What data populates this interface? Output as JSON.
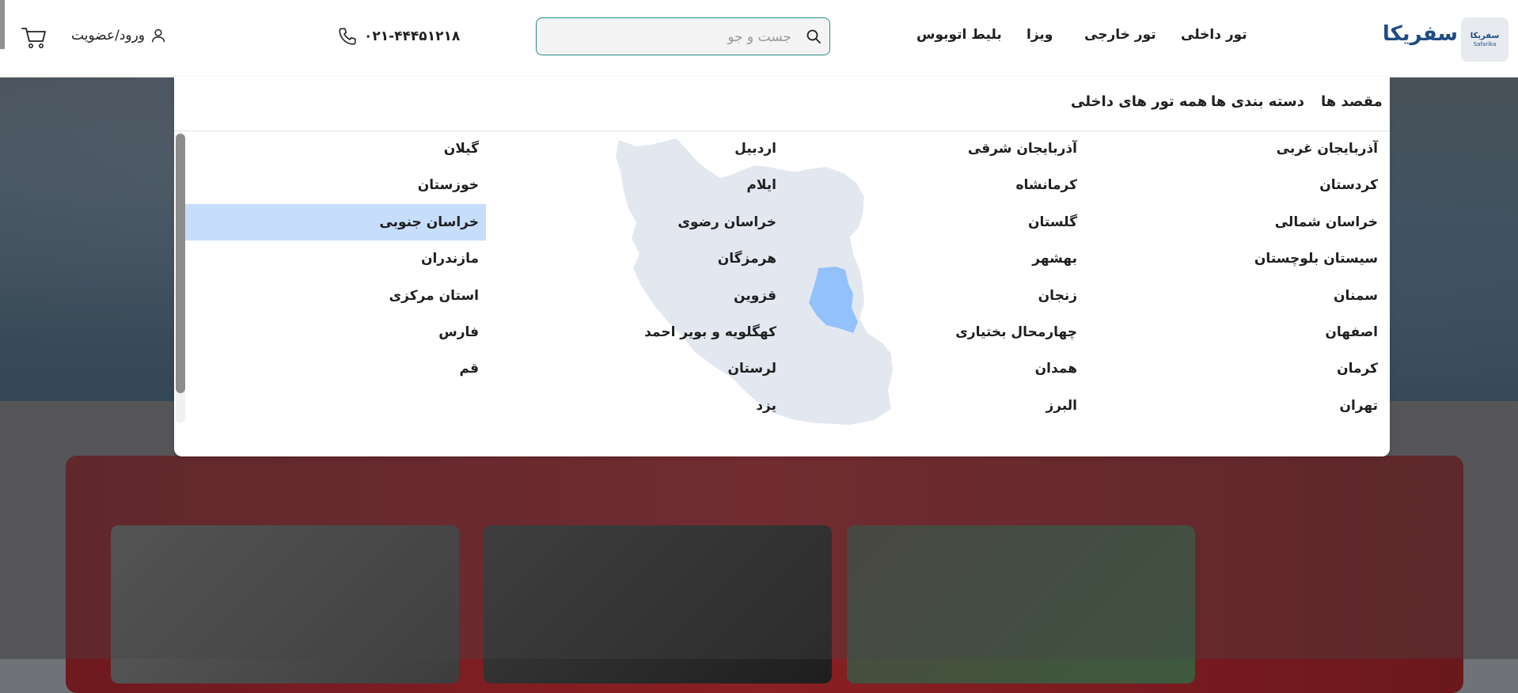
{
  "header": {
    "brand": "سفریکا",
    "logo_text": "سفریکا",
    "logo_subtext": "Safarika",
    "nav": [
      "تور داخلی",
      "تور خارجی",
      "ویزا",
      "بلیط اتوبوس"
    ],
    "search_placeholder": "جست و جو",
    "phone": "۰۲۱-۴۴۴۵۱۲۱۸",
    "login_label": "ورود/عضویت"
  },
  "menu": {
    "tabs": [
      "مقصد ها",
      "دسته بندی ها",
      "همه تور های داخلی"
    ],
    "columns": [
      [
        "آذربایجان غربی",
        "کردستان",
        "خراسان شمالی",
        "سیستان بلوچستان",
        "سمنان",
        "اصفهان",
        "کرمان",
        "تهران"
      ],
      [
        "آذربایجان شرقی",
        "کرمانشاه",
        "گلستان",
        "بهشهر",
        "زنجان",
        "چهارمحال بختیاری",
        "همدان",
        "البرز"
      ],
      [
        "اردبیل",
        "ایلام",
        "خراسان رضوی",
        "هرمزگان",
        "قزوین",
        "کهگلویه و بویر احمد",
        "لرستان",
        "یزد"
      ],
      [
        "گیلان",
        "خوزستان",
        "خراسان جنوبی",
        "مازندران",
        "استان مرکزی",
        "فارس",
        "قم"
      ]
    ],
    "highlighted": "خراسان جنوبی"
  },
  "colors": {
    "accent": "#2c8c86",
    "brand": "#1f4c83",
    "highlight": "#c6ddfb",
    "map_land": "#e3e8f0",
    "map_highlight": "#93c1fc"
  },
  "background": {
    "promo_title": "... ...",
    "promo_sub": "..."
  }
}
